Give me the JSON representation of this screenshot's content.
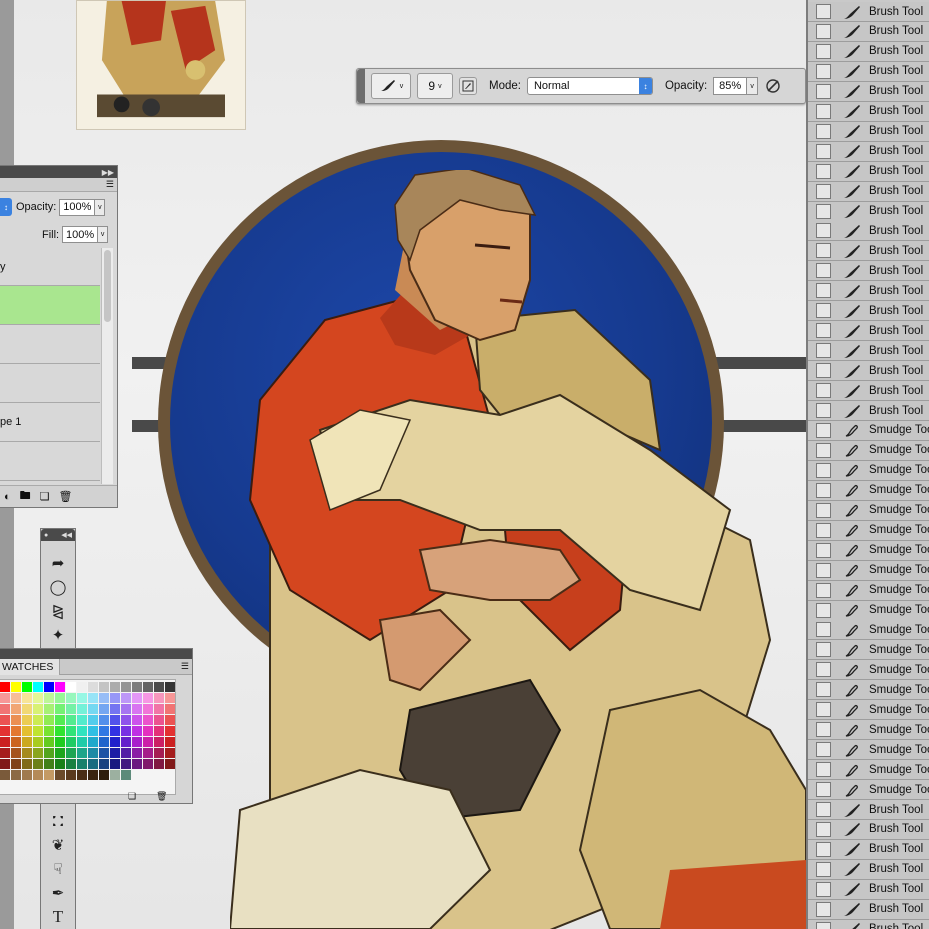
{
  "options_bar": {
    "brush_size": "9",
    "mode_label": "Mode:",
    "mode_value": "Normal",
    "opacity_label": "Opacity:",
    "opacity_value": "85%",
    "icons": [
      "brush-preset-icon",
      "brush-panel-icon",
      "airbrush-icon"
    ]
  },
  "layers_panel": {
    "opacity_label": "Opacity:",
    "opacity_value": "100%",
    "fill_label": "Fill:",
    "fill_value": "100%",
    "layers": [
      {
        "label": "y",
        "active": false
      },
      {
        "label": "",
        "active": true
      },
      {
        "label": "",
        "active": false
      },
      {
        "label": "",
        "active": false
      },
      {
        "label": "pe 1",
        "active": false
      },
      {
        "label": "",
        "active": false
      }
    ],
    "footer_icons": [
      "adjustment-layer-icon",
      "folder-icon",
      "new-layer-icon",
      "trash-icon"
    ]
  },
  "tools_panel": {
    "tools": [
      "move-tool-icon",
      "marquee-tool-icon",
      "lasso-tool-icon",
      "magic-wand-tool-icon",
      "paint-bucket-tool-icon",
      "burn-tool-icon",
      "smudge-tool-icon",
      "pen-tool-icon",
      "type-tool-icon"
    ],
    "type_tool_label": "T"
  },
  "swatches_panel": {
    "tab_label": "WATCHES",
    "footer_icons": [
      "new-swatch-icon",
      "trash-icon"
    ]
  },
  "history_panel": {
    "items": [
      "Brush Tool",
      "Brush Tool",
      "Brush Tool",
      "Brush Tool",
      "Brush Tool",
      "Brush Tool",
      "Brush Tool",
      "Brush Tool",
      "Brush Tool",
      "Brush Tool",
      "Brush Tool",
      "Brush Tool",
      "Brush Tool",
      "Brush Tool",
      "Brush Tool",
      "Brush Tool",
      "Brush Tool",
      "Brush Tool",
      "Brush Tool",
      "Brush Tool",
      "Brush Tool",
      "Smudge Tool",
      "Smudge Tool",
      "Smudge Tool",
      "Smudge Tool",
      "Smudge Tool",
      "Smudge Tool",
      "Smudge Tool",
      "Smudge Tool",
      "Smudge Tool",
      "Smudge Tool",
      "Smudge Tool",
      "Smudge Tool",
      "Smudge Tool",
      "Smudge Tool",
      "Smudge Tool",
      "Smudge Tool",
      "Smudge Tool",
      "Smudge Tool",
      "Smudge Tool",
      "Brush Tool",
      "Brush Tool",
      "Brush Tool",
      "Brush Tool",
      "Brush Tool",
      "Brush Tool",
      "Brush Tool"
    ]
  },
  "colors": {
    "halo_blue": "#163a8f",
    "halo_ring": "#6b5438",
    "sweater_orange": "#d4461f",
    "coat_tan": "#d9c38a",
    "active_layer_green": "#a9e68f",
    "select_accent": "#3b82e0"
  }
}
